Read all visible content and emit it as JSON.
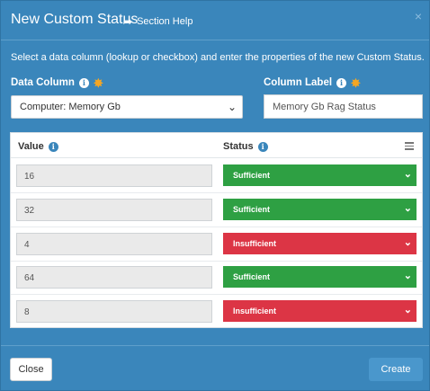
{
  "dialog": {
    "title": "New Custom Status",
    "help_label": "Section Help",
    "close_x": "×"
  },
  "instructions": "Select a data column (lookup or checkbox) and enter the properties of the new Custom Status.",
  "data_column": {
    "label": "Data Column",
    "value": "Computer: Memory Gb"
  },
  "column_label": {
    "label": "Column Label",
    "value": "Memory Gb Rag Status"
  },
  "table": {
    "headers": {
      "value": "Value",
      "status": "Status"
    },
    "rows": [
      {
        "value": "16",
        "status": "Sufficient",
        "color": "#2ea043"
      },
      {
        "value": "32",
        "status": "Sufficient",
        "color": "#2ea043"
      },
      {
        "value": "4",
        "status": "Insufficient",
        "color": "#dc3545"
      },
      {
        "value": "64",
        "status": "Sufficient",
        "color": "#2ea043"
      },
      {
        "value": "8",
        "status": "Insufficient",
        "color": "#dc3545"
      }
    ]
  },
  "footer": {
    "close": "Close",
    "create": "Create"
  },
  "icons": {
    "info": "i",
    "star": "✸",
    "chevron": "⌄"
  }
}
